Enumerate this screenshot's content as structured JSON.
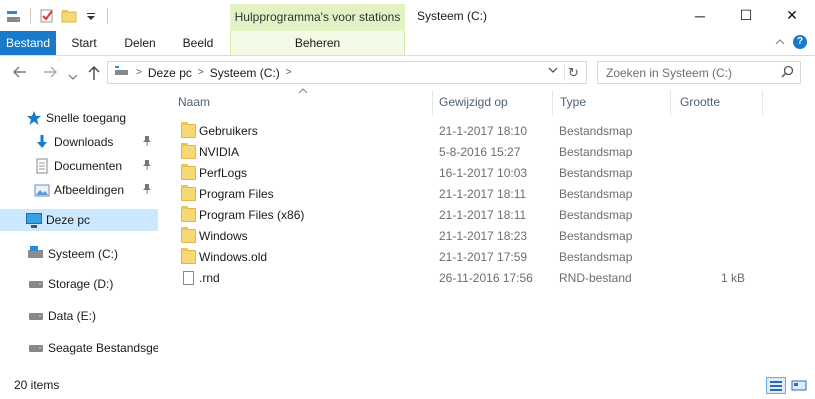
{
  "window": {
    "title": "Systeem (C:)",
    "context_group": "Hulpprogramma's voor stations",
    "controls": {
      "minimize": "─",
      "maximize": "☐",
      "close": "✕"
    }
  },
  "ribbon": {
    "tabs": [
      {
        "label": "Bestand"
      },
      {
        "label": "Start"
      },
      {
        "label": "Delen"
      },
      {
        "label": "Beeld"
      },
      {
        "label": "Beheren"
      }
    ],
    "collapse_icon": "chevron-up-icon",
    "help_label": "?"
  },
  "address": {
    "crumbs": [
      "Deze pc",
      "Systeem (C:)"
    ],
    "search_placeholder": "Zoeken in Systeem (C:)"
  },
  "nav": {
    "items": [
      {
        "label": "Snelle toegang",
        "icon": "star-icon"
      },
      {
        "label": "Downloads",
        "icon": "download-arrow-icon",
        "pinned": true
      },
      {
        "label": "Documenten",
        "icon": "document-icon",
        "pinned": true
      },
      {
        "label": "Afbeeldingen",
        "icon": "pictures-icon",
        "pinned": true
      },
      {
        "label": "Deze pc",
        "icon": "computer-icon",
        "selected": true
      },
      {
        "label": "Systeem (C:)",
        "icon": "windows-drive-icon"
      },
      {
        "label": "Storage (D:)",
        "icon": "drive-icon"
      },
      {
        "label": "Data (E:)",
        "icon": "drive-icon"
      },
      {
        "label": "Seagate Bestandsges",
        "icon": "drive-icon"
      }
    ]
  },
  "list": {
    "columns": [
      "Naam",
      "Gewijzigd op",
      "Type",
      "Grootte"
    ],
    "rows": [
      {
        "name": "Gebruikers",
        "modified": "21-1-2017 18:10",
        "type": "Bestandsmap",
        "size": "",
        "icon": "folder-icon"
      },
      {
        "name": "NVIDIA",
        "modified": "5-8-2016 15:27",
        "type": "Bestandsmap",
        "size": "",
        "icon": "folder-icon"
      },
      {
        "name": "PerfLogs",
        "modified": "16-1-2017 10:03",
        "type": "Bestandsmap",
        "size": "",
        "icon": "folder-icon"
      },
      {
        "name": "Program Files",
        "modified": "21-1-2017 18:11",
        "type": "Bestandsmap",
        "size": "",
        "icon": "folder-icon"
      },
      {
        "name": "Program Files (x86)",
        "modified": "21-1-2017 18:11",
        "type": "Bestandsmap",
        "size": "",
        "icon": "folder-icon"
      },
      {
        "name": "Windows",
        "modified": "21-1-2017 18:23",
        "type": "Bestandsmap",
        "size": "",
        "icon": "folder-icon"
      },
      {
        "name": "Windows.old",
        "modified": "21-1-2017 17:59",
        "type": "Bestandsmap",
        "size": "",
        "icon": "folder-icon"
      },
      {
        "name": ".rnd",
        "modified": "26-11-2016 17:56",
        "type": "RND-bestand",
        "size": "1 kB",
        "icon": "file-icon"
      }
    ]
  },
  "status": {
    "count": "20 items"
  },
  "colors": {
    "accent": "#1979ca",
    "context_tab": "#e2f2c5",
    "selection": "#cce8ff",
    "header_text": "#4c607a"
  }
}
